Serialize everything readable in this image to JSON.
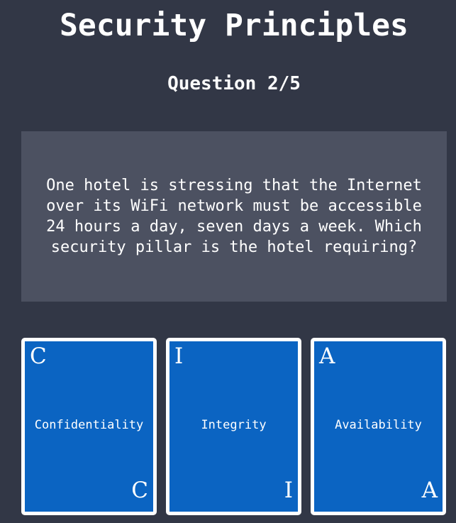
{
  "header": {
    "title": "Security Principles",
    "question_counter": "Question 2/5"
  },
  "question": {
    "text": "One hotel is stressing that the Internet over its WiFi network must be accessible 24 hours a day, seven days a week. Which security pillar is the hotel requiring?"
  },
  "options": [
    {
      "letter": "C",
      "label": "Confidentiality"
    },
    {
      "letter": "I",
      "label": "Integrity"
    },
    {
      "letter": "A",
      "label": "Availability"
    }
  ],
  "colors": {
    "background": "#323746",
    "question_box": "#4c5161",
    "card": "#0b64c2",
    "card_border": "#ffffff",
    "text": "#ffffff"
  }
}
